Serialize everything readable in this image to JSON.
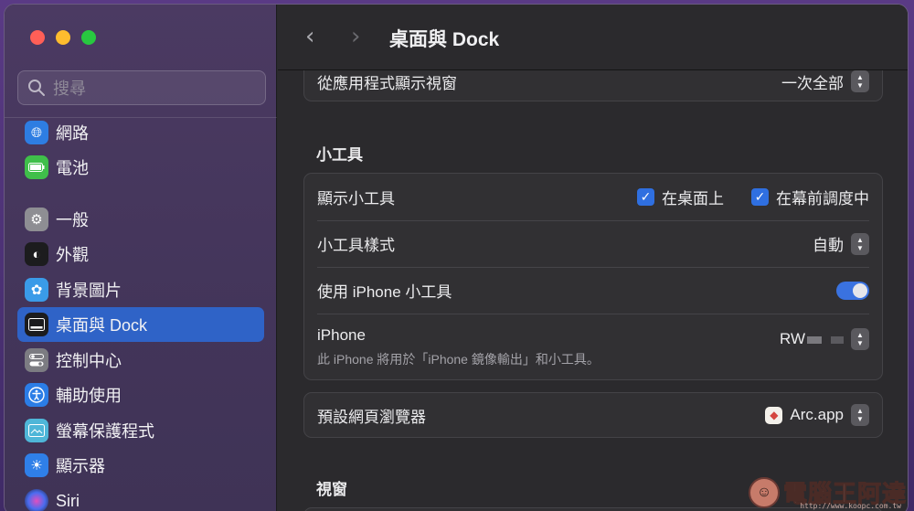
{
  "search": {
    "placeholder": "搜尋"
  },
  "sidebar": {
    "items": [
      {
        "label": "網路",
        "icon": "globe-icon",
        "color": "#2e7de2"
      },
      {
        "label": "電池",
        "icon": "battery-icon",
        "color": "#3fbf4a"
      },
      {
        "label": "一般",
        "icon": "gear-icon",
        "color": "#8e8e93"
      },
      {
        "label": "外觀",
        "icon": "appearance-icon",
        "color": "#1c1c1e"
      },
      {
        "label": "背景圖片",
        "icon": "flower-icon",
        "color": "#3a9be8"
      },
      {
        "label": "桌面與 Dock",
        "icon": "dock-icon",
        "color": "#1c1c1e"
      },
      {
        "label": "控制中心",
        "icon": "toggles-icon",
        "color": "#7c7c82"
      },
      {
        "label": "輔助使用",
        "icon": "accessibility-icon",
        "color": "#2b7de6"
      },
      {
        "label": "螢幕保護程式",
        "icon": "screensaver-icon",
        "color": "#4fb6d8"
      },
      {
        "label": "顯示器",
        "icon": "sun-icon",
        "color": "#2f7fe8"
      },
      {
        "label": "Siri",
        "icon": "siri-icon",
        "color": "#2a2a3a"
      }
    ]
  },
  "header": {
    "title": "桌面與 Dock",
    "back_glyph": "‹",
    "forward_glyph": "›"
  },
  "rows": {
    "show_from_app": {
      "label": "從應用程式顯示視窗",
      "value": "一次全部"
    }
  },
  "widgets_section": {
    "title": "小工具",
    "show_widgets": {
      "label": "顯示小工具",
      "option1": "在桌面上",
      "option2": "在幕前調度中"
    },
    "widget_style": {
      "label": "小工具樣式",
      "value": "自動"
    },
    "use_iphone_widgets": {
      "label": "使用 iPhone 小工具",
      "enabled": true
    },
    "iphone": {
      "label": "iPhone",
      "value": "RW",
      "description": "此 iPhone 將用於「iPhone 鏡像輸出」和小工具。"
    }
  },
  "browser_row": {
    "label": "預設網頁瀏覽器",
    "value": "Arc.app"
  },
  "windows_section": {
    "title": "視窗"
  },
  "watermark": {
    "text": "電腦王阿達",
    "url": "http://www.koopc.com.tw"
  }
}
